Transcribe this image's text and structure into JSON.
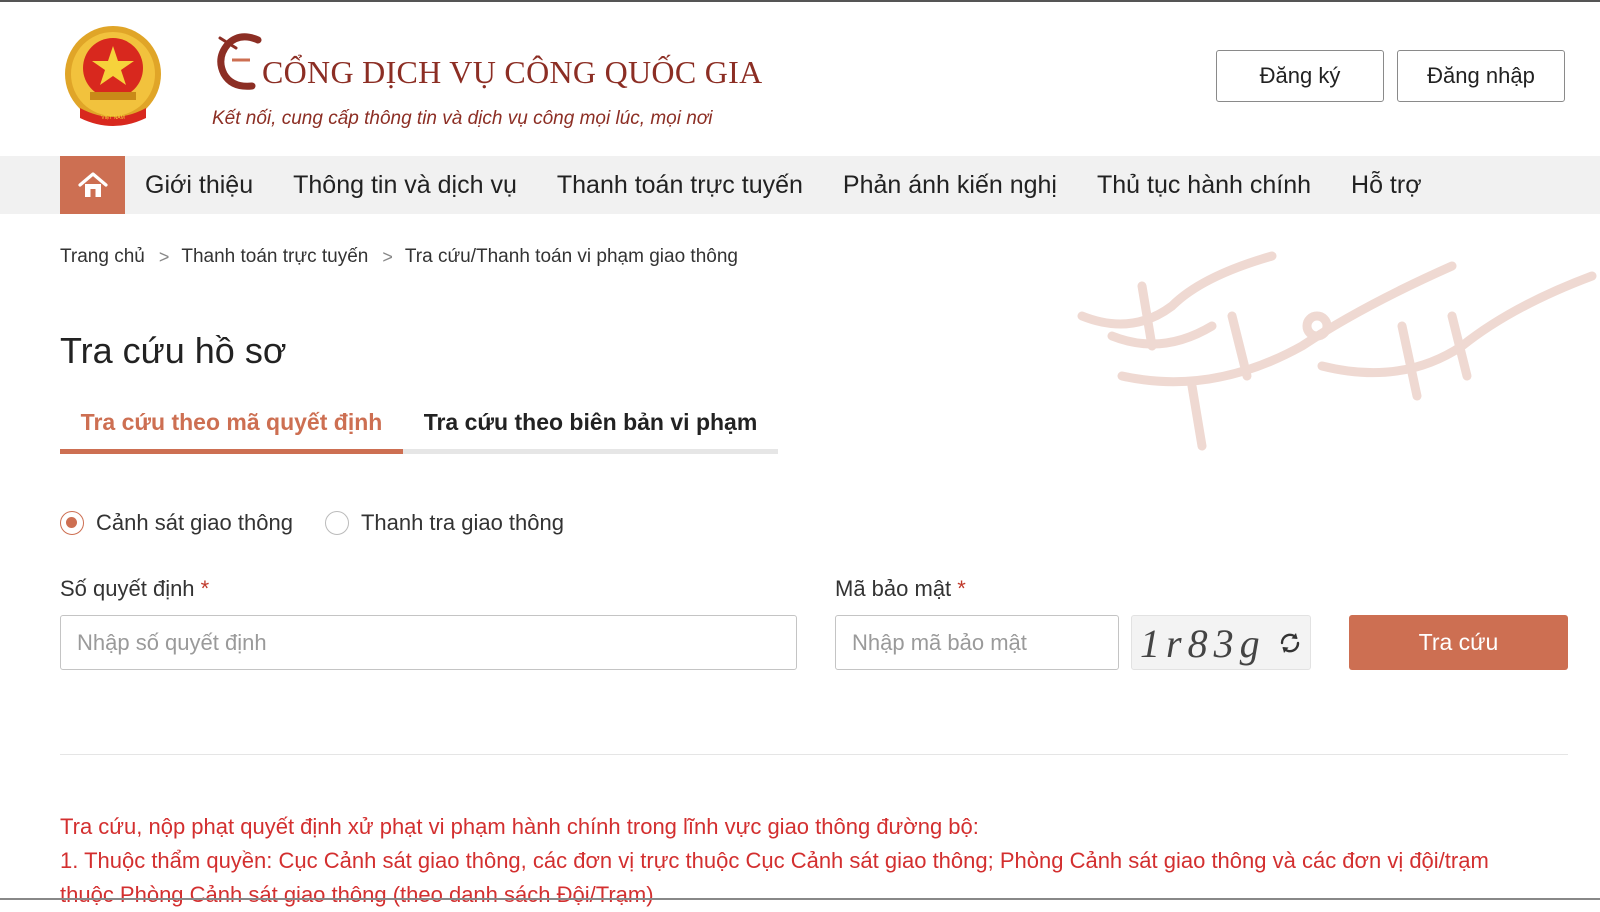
{
  "header": {
    "title": "CỔNG DỊCH VỤ CÔNG QUỐC GIA",
    "subtitle": "Kết nối, cung cấp thông tin và dịch vụ công mọi lúc, mọi nơi",
    "register_label": "Đăng ký",
    "login_label": "Đăng nhập"
  },
  "nav": {
    "home_icon": "home-icon",
    "items": [
      {
        "label": "Giới thiệu"
      },
      {
        "label": "Thông tin và dịch vụ"
      },
      {
        "label": "Thanh toán trực tuyến"
      },
      {
        "label": "Phản ánh kiến nghị"
      },
      {
        "label": "Thủ tục hành chính"
      },
      {
        "label": "Hỗ trợ"
      }
    ]
  },
  "breadcrumb": [
    {
      "label": "Trang chủ"
    },
    {
      "label": "Thanh toán trực tuyến"
    },
    {
      "label": "Tra cứu/Thanh toán vi phạm giao thông"
    }
  ],
  "page_title": "Tra cứu hồ sơ",
  "tabs": [
    {
      "label": "Tra cứu theo mã quyết định",
      "active": true
    },
    {
      "label": "Tra cứu theo biên bản vi phạm",
      "active": false
    }
  ],
  "radios": [
    {
      "label": "Cảnh sát giao thông",
      "checked": true
    },
    {
      "label": "Thanh tra giao thông",
      "checked": false
    }
  ],
  "form": {
    "decision_label": "Số quyết định",
    "decision_placeholder": "Nhập số quyết định",
    "decision_value": "",
    "security_label": "Mã bảo mật",
    "security_placeholder": "Nhập mã bảo mật",
    "security_value": "",
    "required_mark": "*",
    "captcha_text": "1r83g",
    "submit_label": "Tra cứu"
  },
  "notice": {
    "line1": "Tra cứu, nộp phạt quyết định xử phạt vi phạm hành chính trong lĩnh vực giao thông đường bộ:",
    "line2": "1. Thuộc thẩm quyền: Cục Cảnh sát giao thông, các đơn vị trực thuộc Cục Cảnh sát giao thông; Phòng Cảnh sát giao thông và các đơn vị đội/trạm",
    "line3": "thuộc Phòng Cảnh sát giao thông (theo danh sách Đội/Trạm)"
  },
  "colors": {
    "accent": "#cd6f52",
    "brand_text": "#8c2e24",
    "notice_red": "#d32f2f",
    "nav_bg": "#f1f1f1"
  }
}
